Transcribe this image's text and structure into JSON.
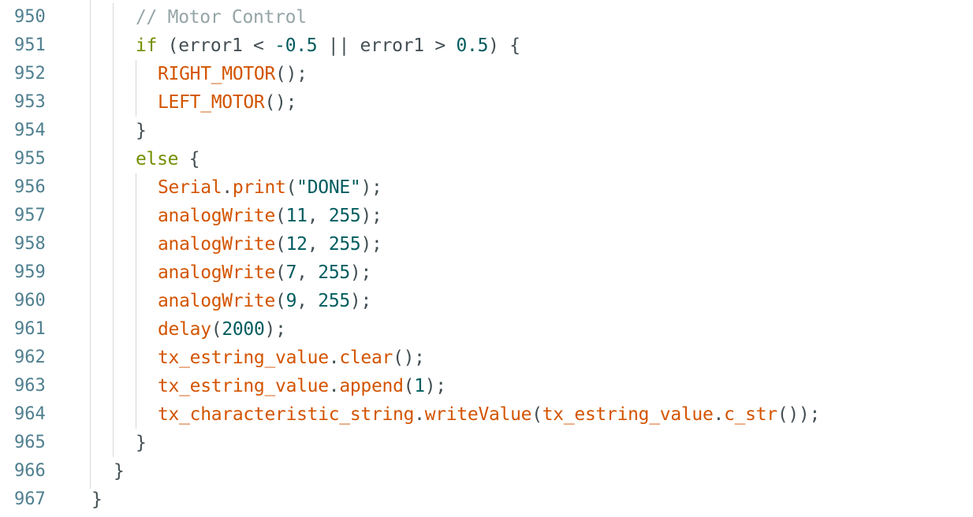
{
  "editor": {
    "colors": {
      "background": "#ffffff",
      "line_number": "#4f7f8f",
      "text": "#434f54",
      "comment": "#95a5a6",
      "keyword": "#728e00",
      "function": "#d35400",
      "literal": "#005c5f",
      "indent_guide": "#d3d9dc"
    },
    "lines": [
      {
        "number": "950",
        "indent": 2,
        "tokens": [
          {
            "t": "// Motor Control",
            "c": "comment"
          }
        ]
      },
      {
        "number": "951",
        "indent": 2,
        "tokens": [
          {
            "t": "if",
            "c": "kw"
          },
          {
            "t": " (error1 < ",
            "c": "p"
          },
          {
            "t": "-0.5",
            "c": "num"
          },
          {
            "t": " || error1 > ",
            "c": "p"
          },
          {
            "t": "0.5",
            "c": "num"
          },
          {
            "t": ") {",
            "c": "p"
          }
        ]
      },
      {
        "number": "952",
        "indent": 3,
        "tokens": [
          {
            "t": "RIGHT_MOTOR",
            "c": "fn"
          },
          {
            "t": "();",
            "c": "p"
          }
        ]
      },
      {
        "number": "953",
        "indent": 3,
        "tokens": [
          {
            "t": "LEFT_MOTOR",
            "c": "fn"
          },
          {
            "t": "();",
            "c": "p"
          }
        ]
      },
      {
        "number": "954",
        "indent": 2,
        "tokens": [
          {
            "t": "}",
            "c": "p"
          }
        ]
      },
      {
        "number": "955",
        "indent": 2,
        "tokens": [
          {
            "t": "else",
            "c": "kw"
          },
          {
            "t": " {",
            "c": "p"
          }
        ]
      },
      {
        "number": "956",
        "indent": 3,
        "tokens": [
          {
            "t": "Serial",
            "c": "fn"
          },
          {
            "t": ".",
            "c": "p"
          },
          {
            "t": "print",
            "c": "fn"
          },
          {
            "t": "(",
            "c": "p"
          },
          {
            "t": "\"DONE\"",
            "c": "str"
          },
          {
            "t": ");",
            "c": "p"
          }
        ]
      },
      {
        "number": "957",
        "indent": 3,
        "tokens": [
          {
            "t": "analogWrite",
            "c": "fn"
          },
          {
            "t": "(",
            "c": "p"
          },
          {
            "t": "11",
            "c": "num"
          },
          {
            "t": ", ",
            "c": "p"
          },
          {
            "t": "255",
            "c": "num"
          },
          {
            "t": ");",
            "c": "p"
          }
        ]
      },
      {
        "number": "958",
        "indent": 3,
        "tokens": [
          {
            "t": "analogWrite",
            "c": "fn"
          },
          {
            "t": "(",
            "c": "p"
          },
          {
            "t": "12",
            "c": "num"
          },
          {
            "t": ", ",
            "c": "p"
          },
          {
            "t": "255",
            "c": "num"
          },
          {
            "t": ");",
            "c": "p"
          }
        ]
      },
      {
        "number": "959",
        "indent": 3,
        "tokens": [
          {
            "t": "analogWrite",
            "c": "fn"
          },
          {
            "t": "(",
            "c": "p"
          },
          {
            "t": "7",
            "c": "num"
          },
          {
            "t": ", ",
            "c": "p"
          },
          {
            "t": "255",
            "c": "num"
          },
          {
            "t": ");",
            "c": "p"
          }
        ]
      },
      {
        "number": "960",
        "indent": 3,
        "tokens": [
          {
            "t": "analogWrite",
            "c": "fn"
          },
          {
            "t": "(",
            "c": "p"
          },
          {
            "t": "9",
            "c": "num"
          },
          {
            "t": ", ",
            "c": "p"
          },
          {
            "t": "255",
            "c": "num"
          },
          {
            "t": ");",
            "c": "p"
          }
        ]
      },
      {
        "number": "961",
        "indent": 3,
        "tokens": [
          {
            "t": "delay",
            "c": "fn"
          },
          {
            "t": "(",
            "c": "p"
          },
          {
            "t": "2000",
            "c": "num"
          },
          {
            "t": ");",
            "c": "p"
          }
        ]
      },
      {
        "number": "962",
        "indent": 3,
        "tokens": [
          {
            "t": "tx_estring_value",
            "c": "fn"
          },
          {
            "t": ".",
            "c": "p"
          },
          {
            "t": "clear",
            "c": "fn"
          },
          {
            "t": "();",
            "c": "p"
          }
        ]
      },
      {
        "number": "963",
        "indent": 3,
        "tokens": [
          {
            "t": "tx_estring_value",
            "c": "fn"
          },
          {
            "t": ".",
            "c": "p"
          },
          {
            "t": "append",
            "c": "fn"
          },
          {
            "t": "(",
            "c": "p"
          },
          {
            "t": "1",
            "c": "num"
          },
          {
            "t": ");",
            "c": "p"
          }
        ]
      },
      {
        "number": "964",
        "indent": 3,
        "tokens": [
          {
            "t": "tx_characteristic_string",
            "c": "fn"
          },
          {
            "t": ".",
            "c": "p"
          },
          {
            "t": "writeValue",
            "c": "fn"
          },
          {
            "t": "(",
            "c": "p"
          },
          {
            "t": "tx_estring_value",
            "c": "fn"
          },
          {
            "t": ".",
            "c": "p"
          },
          {
            "t": "c_str",
            "c": "fn"
          },
          {
            "t": "());",
            "c": "p"
          }
        ]
      },
      {
        "number": "965",
        "indent": 2,
        "tokens": [
          {
            "t": "}",
            "c": "p"
          }
        ]
      },
      {
        "number": "966",
        "indent": 1,
        "tokens": [
          {
            "t": "}",
            "c": "p"
          }
        ]
      },
      {
        "number": "967",
        "indent": 0,
        "tokens": [
          {
            "t": "}",
            "c": "p"
          }
        ]
      }
    ]
  }
}
